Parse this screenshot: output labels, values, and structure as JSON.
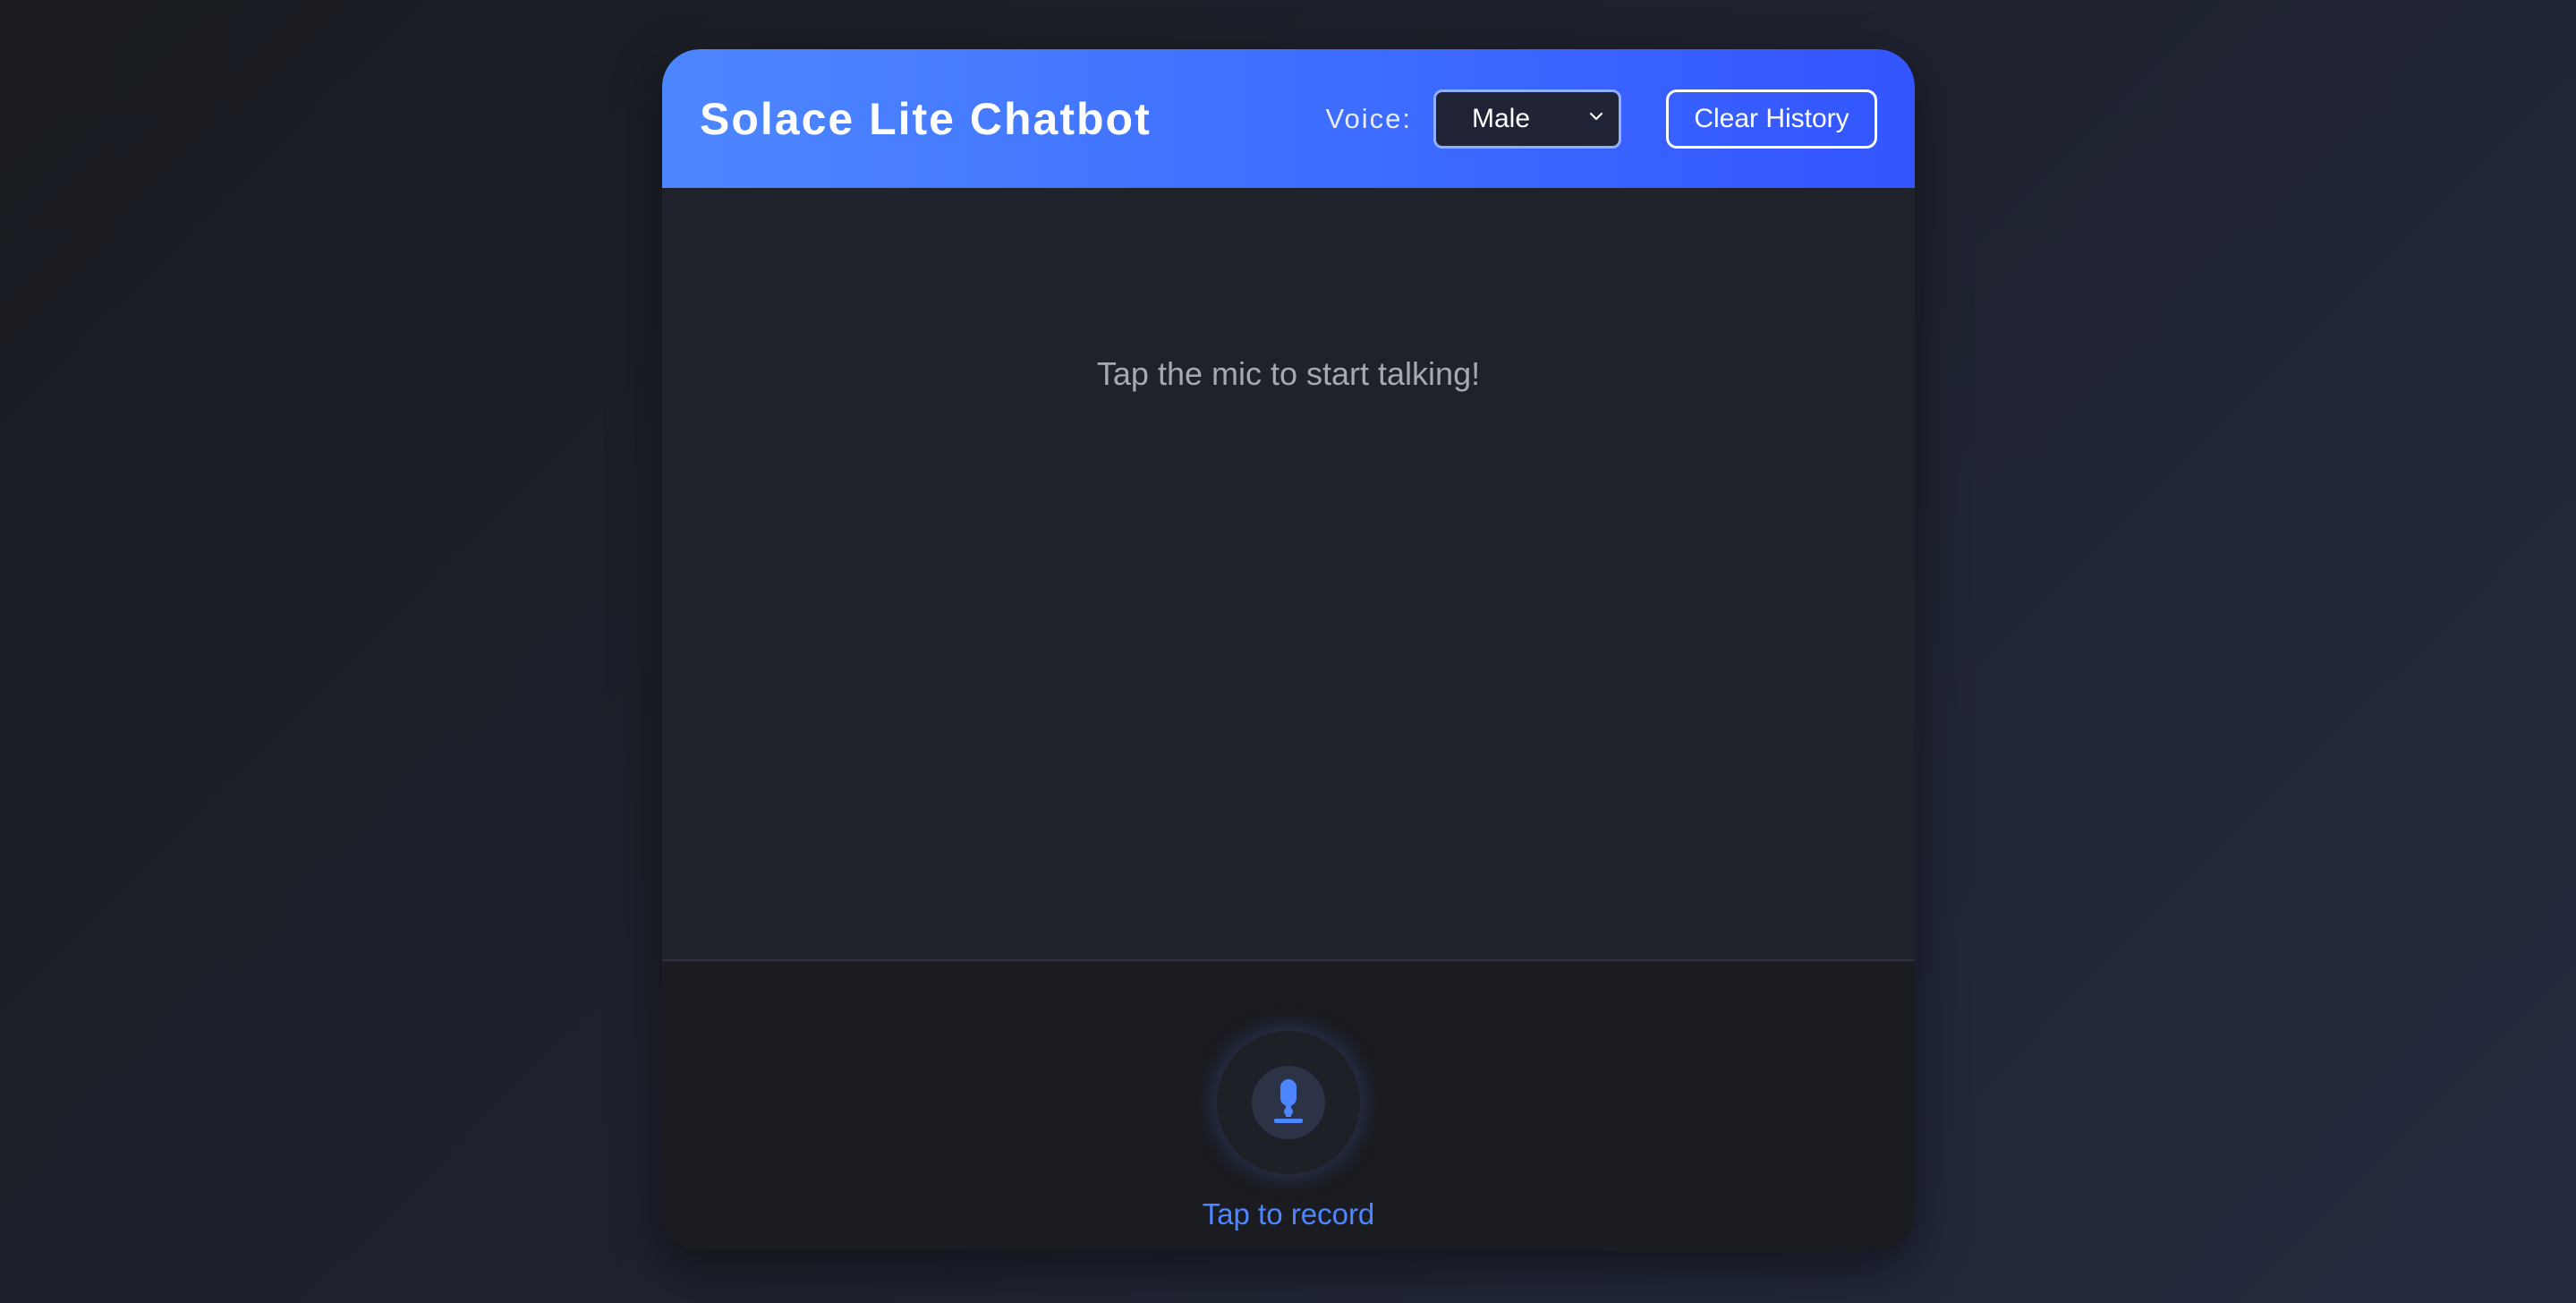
{
  "header": {
    "title": "Solace Lite Chatbot",
    "voice_label": "Voice:",
    "voice_selected": "Male",
    "clear_label": "Clear History"
  },
  "chat": {
    "empty_message": "Tap the mic to start talking!"
  },
  "recorder": {
    "label": "Tap to record",
    "icon": "microphone-icon"
  },
  "colors": {
    "accent": "#4e86ff",
    "header_start": "#4d87ff",
    "header_end": "#3355ff",
    "background": "#1f212b"
  }
}
